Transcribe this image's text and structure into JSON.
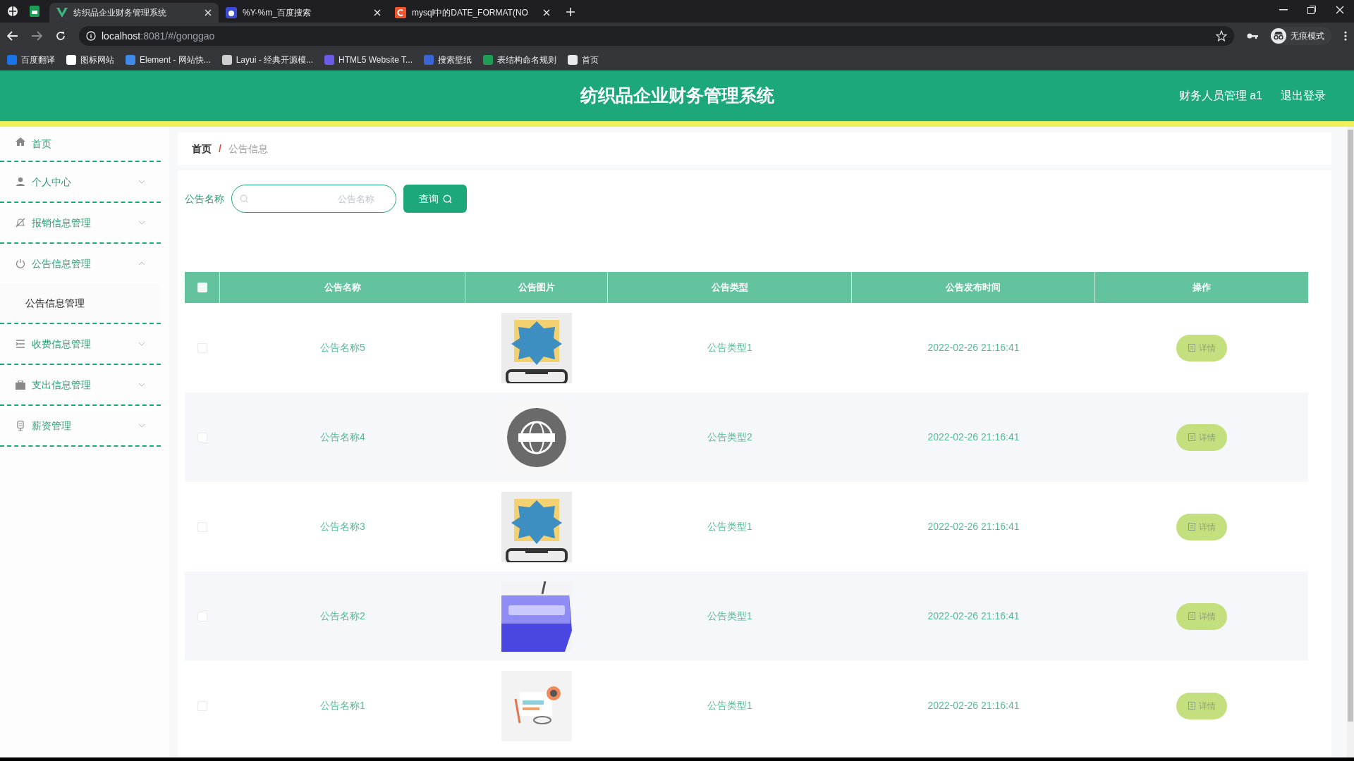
{
  "browser": {
    "tabs": [
      {
        "title": "纺织品企业财务管理系统",
        "selected": true
      },
      {
        "title": "%Y-%m_百度搜索",
        "selected": false
      },
      {
        "title": "mysql中的DATE_FORMAT(NO",
        "selected": false
      }
    ],
    "address": {
      "host": "localhost",
      "path": ":8081/#/gonggao"
    },
    "bookmarks": [
      "百度翻译",
      "图标网站",
      "Element - 网站快...",
      "Layui - 经典开源模...",
      "HTML5 Website T...",
      "搜索壁纸",
      "表结构命名规则",
      "首页"
    ],
    "profile": "无痕模式"
  },
  "header": {
    "title": "纺织品企业财务管理系统",
    "user": "财务人员管理 a1",
    "logout": "退出登录"
  },
  "sidebar": {
    "items": [
      {
        "label": "首页",
        "kind": "link"
      },
      {
        "label": "个人中心",
        "kind": "menu",
        "expanded": false
      },
      {
        "label": "报销信息管理",
        "kind": "menu",
        "expanded": false
      },
      {
        "label": "公告信息管理",
        "kind": "menu",
        "expanded": true,
        "children": [
          {
            "label": "公告信息管理",
            "selected": true
          }
        ]
      },
      {
        "label": "收费信息管理",
        "kind": "menu",
        "expanded": false
      },
      {
        "label": "支出信息管理",
        "kind": "menu",
        "expanded": false
      },
      {
        "label": "薪资管理",
        "kind": "menu",
        "expanded": false
      }
    ]
  },
  "breadcrumb": {
    "home": "首页",
    "separator": "/",
    "current": "公告信息"
  },
  "search": {
    "label": "公告名称",
    "placeholder": "公告名称",
    "button": "查询"
  },
  "table": {
    "select_all": {
      "checked": false
    },
    "columns": [
      "公告名称",
      "公告图片",
      "公告类型",
      "公告发布时间",
      "操作"
    ],
    "rows": [
      {
        "checked": false,
        "name": "公告名称5",
        "type": "公告类型1",
        "time": "2022-02-26 21:16:41",
        "action": "详情"
      },
      {
        "checked": false,
        "name": "公告名称4",
        "type": "公告类型2",
        "time": "2022-02-26 21:16:41",
        "action": "详情"
      },
      {
        "checked": false,
        "name": "公告名称3",
        "type": "公告类型1",
        "time": "2022-02-26 21:16:41",
        "action": "详情"
      },
      {
        "checked": false,
        "name": "公告名称2",
        "type": "公告类型1",
        "time": "2022-02-26 21:16:41",
        "action": "详情"
      },
      {
        "checked": false,
        "name": "公告名称1",
        "type": "公告类型1",
        "time": "2022-02-26 21:16:41",
        "action": "详情"
      }
    ]
  }
}
